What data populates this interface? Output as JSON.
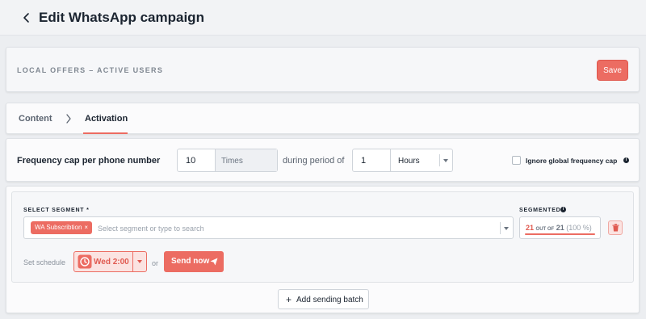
{
  "header": {
    "title": "Edit WhatsApp campaign"
  },
  "campaign": {
    "name": "LOCAL OFFERS – ACTIVE USERS",
    "save_label": "Save"
  },
  "tabs": [
    {
      "label": "Content",
      "active": false
    },
    {
      "label": "Activation",
      "active": true
    }
  ],
  "frequency": {
    "label": "Frequency cap per phone number",
    "times_value": "10",
    "times_suffix": "Times",
    "during_label": "during period of",
    "period_value": "1",
    "period_unit": "Hours",
    "ignore_label": "Ignore global frequency cap",
    "ignore_checked": false
  },
  "segment": {
    "select_label": "SELECT SEGMENT *",
    "tag": "WA Subscribtion",
    "placeholder": "Select segment or type to search",
    "segmented_label": "SEGMENTED",
    "segmented_count": "21",
    "out_of_label": "OUT OF",
    "total_count": "21",
    "percent": "(100 %)",
    "schedule_label": "Set schedule",
    "schedule_value": "Wed 2:00",
    "or_label": "or",
    "send_now_label": "Send now",
    "add_batch_label": "Add sending batch"
  },
  "colors": {
    "accent": "#ec6c62",
    "text": "#1b2430",
    "background": "#eceef1"
  },
  "icons": [
    "chevron-left-icon",
    "chevron-right-icon",
    "info-icon",
    "close-icon",
    "trash-icon",
    "clock-icon",
    "send-icon",
    "plus-icon",
    "caret-down-icon"
  ]
}
